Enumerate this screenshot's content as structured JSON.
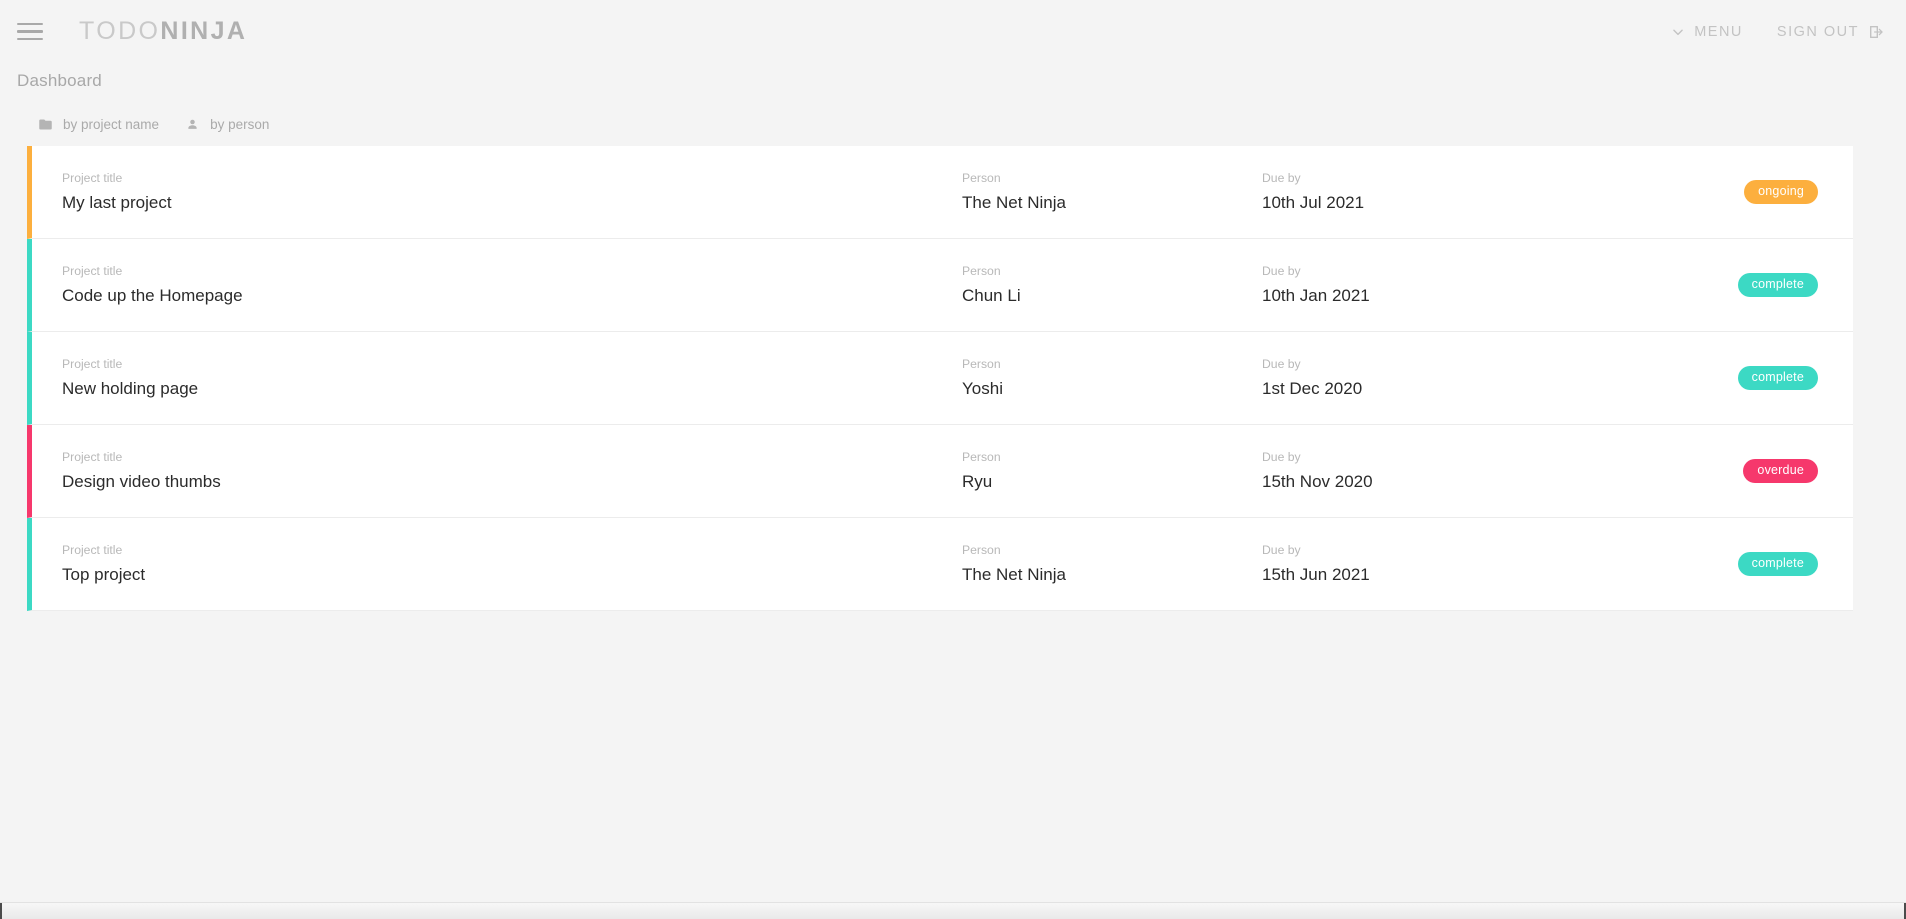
{
  "navbar": {
    "menu_icon": "hamburger-icon",
    "brand_light": "TODO",
    "brand_bold": "NINJA",
    "menu_label": "MENU",
    "menu_icon_name": "chevron-down-icon",
    "signout_label": "SIGN OUT",
    "signout_icon_name": "logout-icon"
  },
  "page": {
    "heading": "Dashboard"
  },
  "filters": [
    {
      "label": "by project name",
      "icon": "folder-icon"
    },
    {
      "label": "by person",
      "icon": "person-icon"
    }
  ],
  "columns": {
    "title": "Project title",
    "person": "Person",
    "due": "Due by"
  },
  "colors": {
    "ongoing": "#fcaf3e",
    "complete": "#3cd9c4",
    "overdue": "#f6386c",
    "background": "#f4f4f4",
    "card": "#ffffff",
    "divider": "#ececec",
    "muted_text": "#b8b8b8",
    "value_text": "#2b2b2b"
  },
  "projects": [
    {
      "title": "My last project",
      "person": "The Net Ninja",
      "due": "10th Jul 2021",
      "status": "ongoing",
      "color": "#fcaf3e"
    },
    {
      "title": "Code up the Homepage",
      "person": "Chun Li",
      "due": "10th Jan 2021",
      "status": "complete",
      "color": "#3cd9c4"
    },
    {
      "title": "New holding page",
      "person": "Yoshi",
      "due": "1st Dec 2020",
      "status": "complete",
      "color": "#3cd9c4"
    },
    {
      "title": "Design video thumbs",
      "person": "Ryu",
      "due": "15th Nov 2020",
      "status": "overdue",
      "color": "#f6386c"
    },
    {
      "title": "Top project",
      "person": "The Net Ninja",
      "due": "15th Jun 2021",
      "status": "complete",
      "color": "#3cd9c4"
    }
  ]
}
